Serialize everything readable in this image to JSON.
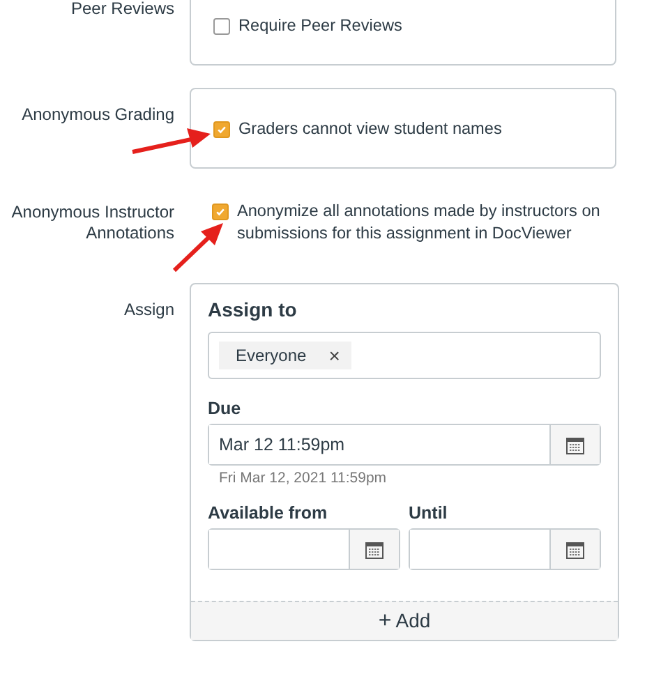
{
  "sections": [
    {
      "label": "Peer Reviews",
      "options": [
        {
          "text": "Require Peer Reviews",
          "checked": false
        }
      ],
      "boxed": true
    },
    {
      "label": "Anonymous Grading",
      "options": [
        {
          "text": "Graders cannot view student names",
          "checked": true
        }
      ],
      "boxed": true
    },
    {
      "label": "Anonymous Instructor Annotations",
      "options": [
        {
          "text": "Anonymize all annotations made by instructors on submissions for this assignment in DocViewer",
          "checked": true
        }
      ],
      "boxed": false
    }
  ],
  "assign": {
    "label": "Assign",
    "card_title": "Assign to",
    "tags": [
      {
        "text": "Everyone",
        "remove": "×"
      }
    ],
    "due": {
      "label": "Due",
      "value": "Mar 12 11:59pm",
      "hint": "Fri Mar 12, 2021 11:59pm"
    },
    "available_from": {
      "label": "Available from"
    },
    "until": {
      "label": "Until"
    },
    "add": {
      "icon": "+",
      "text": "Add"
    }
  }
}
